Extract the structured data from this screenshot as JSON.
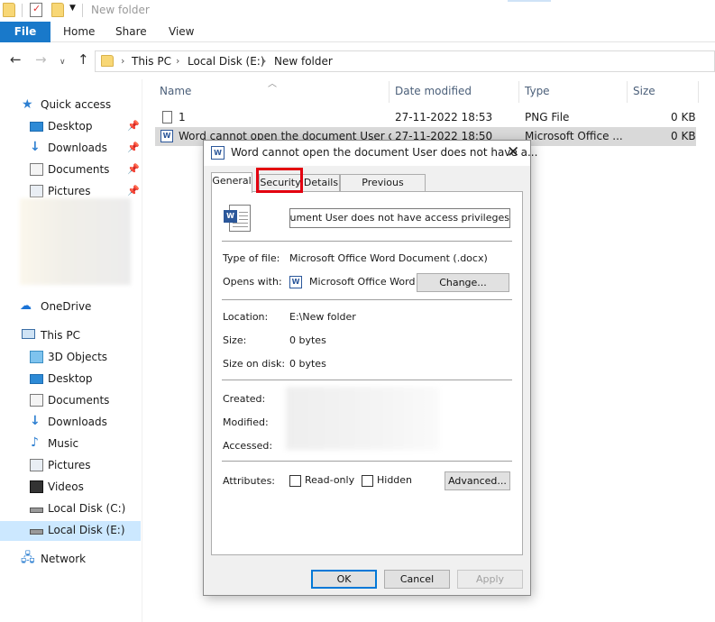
{
  "window": {
    "title": "New folder"
  },
  "ribbon": {
    "file": "File",
    "tabs": [
      "Home",
      "Share",
      "View"
    ]
  },
  "address": {
    "crumbs": [
      "This PC",
      "Local Disk (E:)",
      "New folder"
    ]
  },
  "nav": {
    "quick_access": "Quick access",
    "quick_items": [
      "Desktop",
      "Downloads",
      "Documents",
      "Pictures"
    ],
    "onedrive": "OneDrive",
    "this_pc": "This PC",
    "pc_items": [
      "3D Objects",
      "Desktop",
      "Documents",
      "Downloads",
      "Music",
      "Pictures",
      "Videos",
      "Local Disk (C:)",
      "Local Disk (E:)"
    ],
    "network": "Network",
    "selected": "Local Disk (E:)"
  },
  "list": {
    "columns": [
      "Name",
      "Date modified",
      "Type",
      "Size"
    ],
    "rows": [
      {
        "name": "1",
        "date": "27-11-2022 18:53",
        "type": "PNG File",
        "size": "0 KB"
      },
      {
        "name": "Word cannot open the document User does not have access privileges",
        "date": "27-11-2022 18:50",
        "type": "Microsoft Office ...",
        "size": "0 KB"
      }
    ]
  },
  "dialog": {
    "title": "Word cannot open the document User does not have a...",
    "close": "✕",
    "tabs": [
      "General",
      "Security",
      "Details",
      "Previous Versions"
    ],
    "active_tab": "General",
    "highlighted_tab": "Security",
    "filename": "Word cannot open the document User does not have access privileges",
    "labels": {
      "type": "Type of file:",
      "opens": "Opens with:",
      "location": "Location:",
      "size": "Size:",
      "size_on_disk": "Size on disk:",
      "created": "Created:",
      "modified": "Modified:",
      "accessed": "Accessed:",
      "attributes": "Attributes:"
    },
    "values": {
      "type": "Microsoft Office Word Document (.docx)",
      "opens": "Microsoft Office Word",
      "location": "E:\\New folder",
      "size": "0 bytes",
      "size_on_disk": "0 bytes"
    },
    "buttons": {
      "change": "Change...",
      "advanced": "Advanced...",
      "ok": "OK",
      "cancel": "Cancel",
      "apply": "Apply"
    },
    "checkboxes": {
      "readonly": "Read-only",
      "hidden": "Hidden"
    }
  },
  "colors": {
    "accent": "#1979ca",
    "highlight": "#e3000f",
    "selection": "#cce8ff"
  }
}
